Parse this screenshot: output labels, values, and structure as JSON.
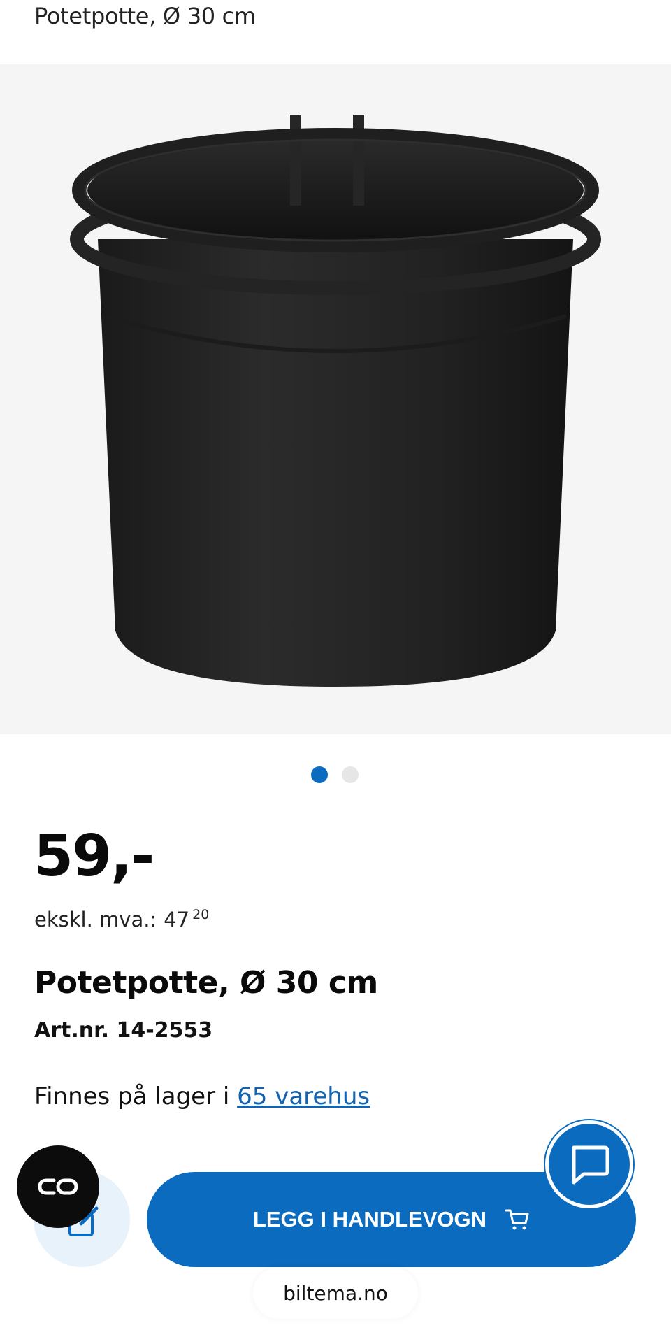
{
  "header": {
    "title": "Potetpotte, Ø 30 cm"
  },
  "gallery": {
    "image_name": "black-plant-pot-image",
    "slide_count": 2,
    "active_slide": 1
  },
  "product": {
    "price": "59,-",
    "vat_label": "ekskl. mva.:",
    "vat_whole": "47",
    "vat_fraction": "20",
    "name": "Potetpotte, Ø 30 cm",
    "article_number": "Art.nr. 14-2553",
    "stock_prefix": "Finnes på lager i ",
    "stock_link": "65 varehus"
  },
  "actions": {
    "add_to_cart_label": "LEGG I HANDLEVOGN",
    "cart_icon": "cart-icon",
    "edit_icon": "edit-icon",
    "chat_icon": "chat-icon",
    "co_icon": "co-icon"
  },
  "browser": {
    "url": "biltema.no"
  },
  "colors": {
    "accent": "#0a6bbf",
    "link": "#1363b3",
    "image_bg": "#f5f5f5",
    "dot_inactive": "#e6e6e6"
  }
}
